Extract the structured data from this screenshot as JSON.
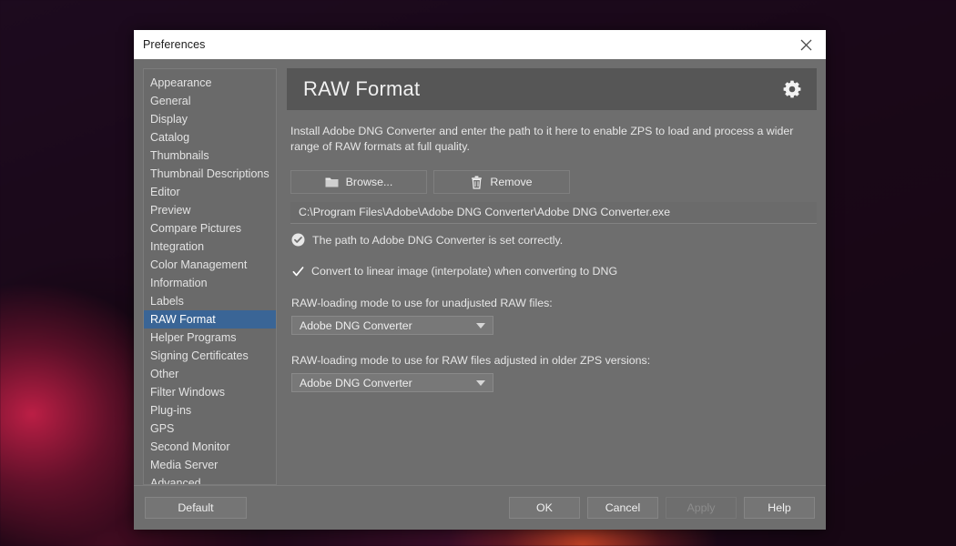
{
  "window": {
    "title": "Preferences",
    "close_icon": "close-icon"
  },
  "sidebar": {
    "items": [
      {
        "label": "Appearance",
        "selected": false
      },
      {
        "label": "General",
        "selected": false
      },
      {
        "label": "Display",
        "selected": false
      },
      {
        "label": "Catalog",
        "selected": false
      },
      {
        "label": "Thumbnails",
        "selected": false
      },
      {
        "label": "Thumbnail Descriptions",
        "selected": false
      },
      {
        "label": "Editor",
        "selected": false
      },
      {
        "label": "Preview",
        "selected": false
      },
      {
        "label": "Compare Pictures",
        "selected": false
      },
      {
        "label": "Integration",
        "selected": false
      },
      {
        "label": "Color Management",
        "selected": false
      },
      {
        "label": "Information",
        "selected": false
      },
      {
        "label": "Labels",
        "selected": false
      },
      {
        "label": "RAW Format",
        "selected": true
      },
      {
        "label": "Helper Programs",
        "selected": false
      },
      {
        "label": "Signing Certificates",
        "selected": false
      },
      {
        "label": "Other",
        "selected": false
      },
      {
        "label": "Filter Windows",
        "selected": false
      },
      {
        "label": "Plug-ins",
        "selected": false
      },
      {
        "label": "GPS",
        "selected": false
      },
      {
        "label": "Second Monitor",
        "selected": false
      },
      {
        "label": "Media Server",
        "selected": false
      },
      {
        "label": "Advanced",
        "selected": false
      }
    ],
    "selected_label": "RAW Format"
  },
  "panel": {
    "title": "RAW Format",
    "settings_icon": "gear-icon",
    "description": "Install Adobe DNG Converter and enter the path to it here to enable ZPS to load and process a wider range of RAW formats at full quality.",
    "browse_label": "Browse...",
    "browse_icon": "folder-icon",
    "remove_label": "Remove",
    "remove_icon": "trash-icon",
    "path_value": "C:\\Program Files\\Adobe\\Adobe DNG Converter\\Adobe DNG Converter.exe",
    "status_icon": "check-circle-icon",
    "status_text": "The path to Adobe DNG Converter is set correctly.",
    "convert_checkbox_label": "Convert to linear image (interpolate) when converting to DNG",
    "convert_checkbox_checked": true,
    "unadjusted_label": "RAW-loading mode to use for unadjusted RAW files:",
    "unadjusted_value": "Adobe DNG Converter",
    "older_versions_label": "RAW-loading mode to use for RAW files adjusted in older ZPS versions:",
    "older_versions_value": "Adobe DNG Converter"
  },
  "footer": {
    "default_label": "Default",
    "ok_label": "OK",
    "cancel_label": "Cancel",
    "apply_label": "Apply",
    "apply_disabled": true,
    "help_label": "Help"
  },
  "colors": {
    "dialog_bg": "#6e6e6e",
    "sidebar_bg": "#6a6a6a",
    "selection_blue": "#3a6596",
    "header_bg": "#565656",
    "titlebar_bg": "#ffffff"
  }
}
